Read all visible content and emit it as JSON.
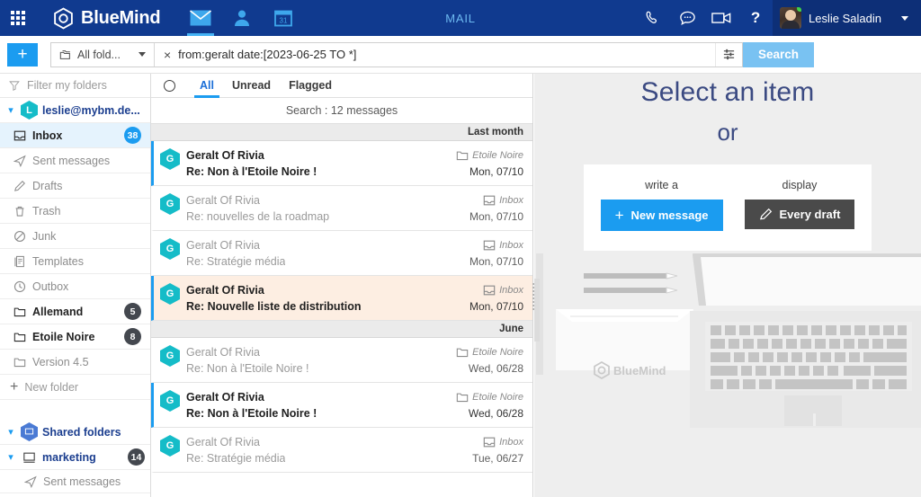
{
  "topbar": {
    "app_launcher": "Apps",
    "brand": "BlueMind",
    "title": "MAIL",
    "apps": [
      {
        "name": "mail",
        "active": true
      },
      {
        "name": "contacts",
        "active": false
      },
      {
        "name": "calendar",
        "active": false,
        "day": "31"
      }
    ],
    "tools": [
      "phone-icon",
      "chat-icon",
      "video-icon",
      "help-icon"
    ],
    "user_name": "Leslie Saladin"
  },
  "search": {
    "compose_plus": "+",
    "folder_scope": "All fold...",
    "clear": "×",
    "query": "from:geralt date:[2023-06-25 TO *]",
    "advanced_title": "Advanced search",
    "search_label": "Search"
  },
  "sidebar": {
    "filter_placeholder": "Filter my folders",
    "account": {
      "initial": "L",
      "label": "leslie@mybm.de..."
    },
    "folders": [
      {
        "label": "Inbox",
        "icon": "inbox-icon",
        "count": "38",
        "selected": true,
        "bold": true,
        "badge_color": "blue"
      },
      {
        "label": "Sent messages",
        "icon": "sent-icon",
        "count": "",
        "selected": false,
        "bold": false
      },
      {
        "label": "Drafts",
        "icon": "draft-icon",
        "count": "",
        "selected": false,
        "bold": false
      },
      {
        "label": "Trash",
        "icon": "trash-icon",
        "count": "",
        "selected": false,
        "bold": false
      },
      {
        "label": "Junk",
        "icon": "junk-icon",
        "count": "",
        "selected": false,
        "bold": false
      },
      {
        "label": "Templates",
        "icon": "template-icon",
        "count": "",
        "selected": false,
        "bold": false
      },
      {
        "label": "Outbox",
        "icon": "outbox-icon",
        "count": "",
        "selected": false,
        "bold": false
      },
      {
        "label": "Allemand",
        "icon": "folder-icon",
        "count": "5",
        "selected": false,
        "bold": true
      },
      {
        "label": "Etoile Noire",
        "icon": "folder-icon",
        "count": "8",
        "selected": false,
        "bold": true
      },
      {
        "label": "Version 4.5",
        "icon": "folder-icon",
        "count": "",
        "selected": false,
        "bold": false
      }
    ],
    "new_folder": "New folder",
    "shared_folders": "Shared folders",
    "marketing": {
      "label": "marketing",
      "count": "14"
    },
    "marketing_child": "Sent messages"
  },
  "messagelist": {
    "tabs": [
      {
        "label": "All",
        "active": true
      },
      {
        "label": "Unread",
        "active": false
      },
      {
        "label": "Flagged",
        "active": false
      }
    ],
    "result_count": "Search : 12 messages",
    "groups": [
      {
        "title": "Last month",
        "messages": [
          {
            "initial": "G",
            "from": "Geralt Of Rivia",
            "subject": "Re: Non à l'Etoile Noire !",
            "folder": "Etoile Noire",
            "folder_icon": "folder-icon",
            "date": "Mon, 07/10",
            "unread": true,
            "selected": false
          },
          {
            "initial": "G",
            "from": "Geralt Of Rivia",
            "subject": "Re: nouvelles de la roadmap",
            "folder": "Inbox",
            "folder_icon": "inbox-icon",
            "date": "Mon, 07/10",
            "unread": false,
            "selected": false
          },
          {
            "initial": "G",
            "from": "Geralt Of Rivia",
            "subject": "Re: Stratégie média",
            "folder": "Inbox",
            "folder_icon": "inbox-icon",
            "date": "Mon, 07/10",
            "unread": false,
            "selected": false
          },
          {
            "initial": "G",
            "from": "Geralt Of Rivia",
            "subject": "Re: Nouvelle liste de distribution",
            "folder": "Inbox",
            "folder_icon": "inbox-icon",
            "date": "Mon, 07/10",
            "unread": true,
            "selected": true
          }
        ]
      },
      {
        "title": "June",
        "messages": [
          {
            "initial": "G",
            "from": "Geralt Of Rivia",
            "subject": "Re: Non à l'Etoile Noire !",
            "folder": "Etoile Noire",
            "folder_icon": "folder-icon",
            "date": "Wed, 06/28",
            "unread": false,
            "selected": false
          },
          {
            "initial": "G",
            "from": "Geralt Of Rivia",
            "subject": "Re: Non à l'Etoile Noire !",
            "folder": "Etoile Noire",
            "folder_icon": "folder-icon",
            "date": "Wed, 06/28",
            "unread": true,
            "selected": false
          },
          {
            "initial": "G",
            "from": "Geralt Of Rivia",
            "subject": "Re: Stratégie média",
            "folder": "Inbox",
            "folder_icon": "inbox-icon",
            "date": "Tue, 06/27",
            "unread": false,
            "selected": false
          }
        ]
      }
    ]
  },
  "rightpane": {
    "title": "Select an item",
    "or": "or",
    "write_label": "write a",
    "new_message": "New message",
    "display_label": "display",
    "every_draft": "Every draft",
    "illustration_brand": "BlueMind"
  },
  "colors": {
    "header_blue": "#103a8f",
    "accent_blue": "#1b9cf0",
    "selected_row": "#fdeee2",
    "avatar_teal": "#15bcc8",
    "link_navy": "#1b3e8f"
  }
}
